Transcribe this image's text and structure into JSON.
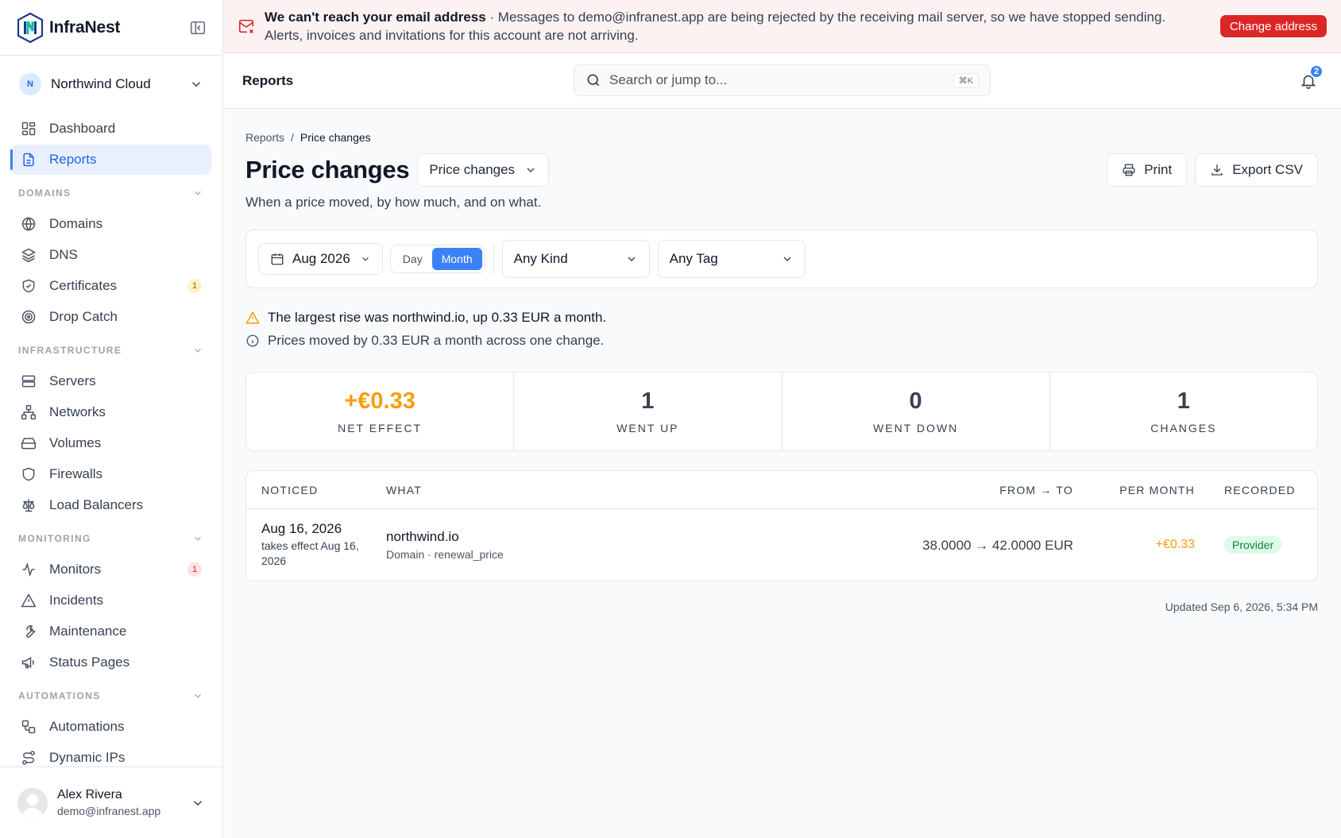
{
  "brand": {
    "name": "InfraNest"
  },
  "org": {
    "initial": "N",
    "name": "Northwind Cloud"
  },
  "nav": {
    "top": [
      {
        "label": "Dashboard",
        "icon": "dashboard-icon"
      },
      {
        "label": "Reports",
        "icon": "document-icon",
        "active": true
      }
    ],
    "sections": [
      {
        "title": "DOMAINS",
        "items": [
          {
            "label": "Domains",
            "icon": "globe-icon"
          },
          {
            "label": "DNS",
            "icon": "layers-icon"
          },
          {
            "label": "Certificates",
            "icon": "shield-check-icon",
            "badge": "1",
            "badge_color": "#b45309"
          },
          {
            "label": "Drop Catch",
            "icon": "target-icon"
          }
        ]
      },
      {
        "title": "INFRASTRUCTURE",
        "items": [
          {
            "label": "Servers",
            "icon": "server-icon"
          },
          {
            "label": "Networks",
            "icon": "network-icon"
          },
          {
            "label": "Volumes",
            "icon": "hard-drive-icon"
          },
          {
            "label": "Firewalls",
            "icon": "shield-icon"
          },
          {
            "label": "Load Balancers",
            "icon": "scale-icon"
          }
        ]
      },
      {
        "title": "MONITORING",
        "items": [
          {
            "label": "Monitors",
            "icon": "activity-icon",
            "badge": "1",
            "badge_color": "#dc2626"
          },
          {
            "label": "Incidents",
            "icon": "alert-triangle-icon"
          },
          {
            "label": "Maintenance",
            "icon": "wrench-icon"
          },
          {
            "label": "Status Pages",
            "icon": "megaphone-icon"
          }
        ]
      },
      {
        "title": "AUTOMATIONS",
        "items": [
          {
            "label": "Automations",
            "icon": "workflow-icon"
          },
          {
            "label": "Dynamic IPs",
            "icon": "route-icon"
          }
        ]
      }
    ]
  },
  "user": {
    "name": "Alex Rivera",
    "email": "demo@infranest.app"
  },
  "banner": {
    "title": "We can't reach your email address",
    "message": " · Messages to demo@infranest.app are being rejected by the receiving mail server, so we have stopped sending. Alerts, invoices and invitations for this account are not arriving.",
    "button": "Change address",
    "accent": "#dc2626"
  },
  "topbar": {
    "title": "Reports",
    "search_placeholder": "Search or jump to...",
    "shortcut": "⌘K",
    "notification_count": "2"
  },
  "breadcrumb": {
    "parent": "Reports",
    "sep": "/",
    "current": "Price changes"
  },
  "page": {
    "title": "Price changes",
    "report_select": "Price changes",
    "subtitle": "When a price moved, by how much, and on what.",
    "print_label": "Print",
    "export_label": "Export CSV"
  },
  "filters": {
    "period": "Aug 2026",
    "granularity": [
      "Day",
      "Month"
    ],
    "granularity_selected": "Month",
    "kind": "Any Kind",
    "tag": "Any Tag"
  },
  "notes": {
    "warning": "The largest rise was northwind.io, up 0.33 EUR a month.",
    "info": "Prices moved by 0.33 EUR a month across one change."
  },
  "stats": [
    {
      "value": "+€0.33",
      "label": "NET EFFECT",
      "highlight": true
    },
    {
      "value": "1",
      "label": "WENT UP"
    },
    {
      "value": "0",
      "label": "WENT DOWN"
    },
    {
      "value": "1",
      "label": "CHANGES"
    }
  ],
  "table": {
    "headers": [
      "NOTICED",
      "WHAT",
      "FROM → TO",
      "PER MONTH",
      "RECORDED"
    ],
    "rows": [
      {
        "noticed": "Aug 16, 2026",
        "effective": "takes effect Aug 16, 2026",
        "what": "northwind.io",
        "what_sub": "Domain · renewal_price",
        "from_to": "38.0000 → 42.0000 EUR",
        "per_month": "+€0.33",
        "recorded": "Provider"
      }
    ]
  },
  "updated": "Updated Sep 6, 2026, 5:34 PM",
  "colors": {
    "accent": "#3b82f6",
    "positive_change": "#f59e0b",
    "danger": "#dc2626",
    "success": "#15803d"
  }
}
